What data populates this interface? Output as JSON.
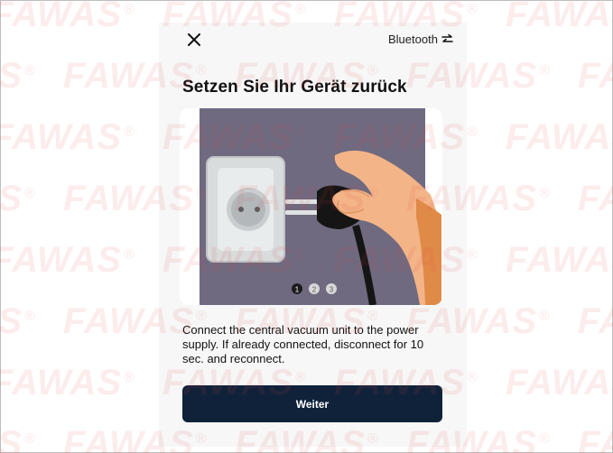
{
  "header": {
    "close_icon": "close-icon",
    "bluetooth_label": "Bluetooth",
    "bluetooth_icon": "swap-arrows-icon"
  },
  "title": "Setzen Sie Ihr Gerät zurück",
  "illustration": {
    "description_icon": "unplug-socket-illustration",
    "pager": [
      "1",
      "2",
      "3"
    ],
    "active_page": 1
  },
  "instructions": "Connect the central vacuum unit to the power supply. If already connected, disconnect for 10 sec. and reconnect.",
  "primary_button": "Weiter",
  "watermark": {
    "text": "FAWAS",
    "mark": "®",
    "color": "#e04646"
  }
}
